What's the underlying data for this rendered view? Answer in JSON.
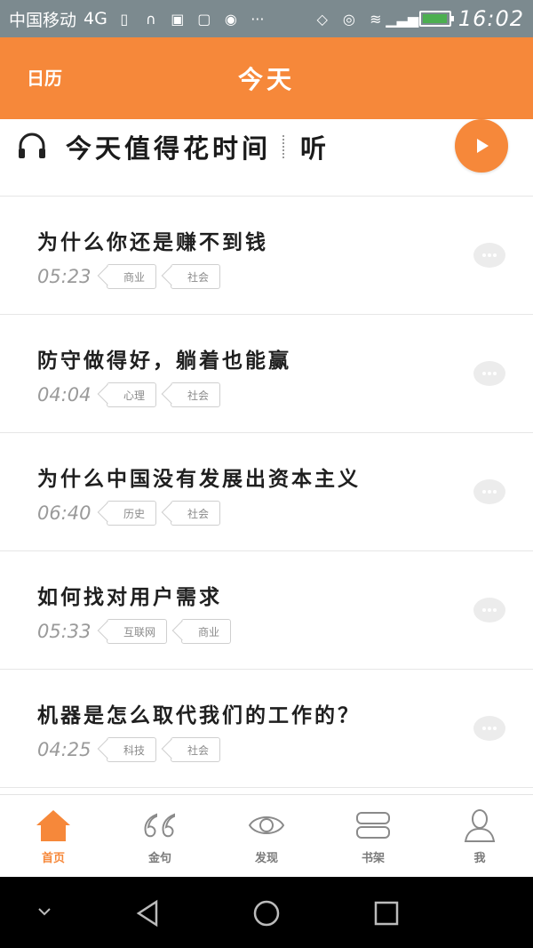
{
  "status_bar": {
    "carrier": "中国移动",
    "network": "4G",
    "time": "16:02",
    "battery_level": 0.95
  },
  "app_bar": {
    "calendar_label": "日历",
    "title": "今天"
  },
  "audio_bar": {
    "title": "今天值得花时间",
    "listen_label": "听"
  },
  "articles": [
    {
      "title": "为什么你还是赚不到钱",
      "duration": "05:23",
      "tags": [
        "商业",
        "社会"
      ]
    },
    {
      "title": "防守做得好，躺着也能赢",
      "duration": "04:04",
      "tags": [
        "心理",
        "社会"
      ]
    },
    {
      "title": "为什么中国没有发展出资本主义",
      "duration": "06:40",
      "tags": [
        "历史",
        "社会"
      ]
    },
    {
      "title": "如何找对用户需求",
      "duration": "05:33",
      "tags": [
        "互联网",
        "商业"
      ]
    },
    {
      "title": "机器是怎么取代我们的工作的？",
      "duration": "04:25",
      "tags": [
        "科技",
        "社会"
      ]
    }
  ],
  "tabs": [
    {
      "label": "首页",
      "icon": "home-icon",
      "active": true
    },
    {
      "label": "金句",
      "icon": "quote-icon",
      "active": false
    },
    {
      "label": "发现",
      "icon": "eye-icon",
      "active": false
    },
    {
      "label": "书架",
      "icon": "bookshelf-icon",
      "active": false
    },
    {
      "label": "我",
      "icon": "person-icon",
      "active": false
    }
  ],
  "colors": {
    "accent": "#f6883a",
    "status_bar": "#7c8a8f",
    "text_dark": "#1f1f1f",
    "text_muted": "#9a9a9a"
  }
}
